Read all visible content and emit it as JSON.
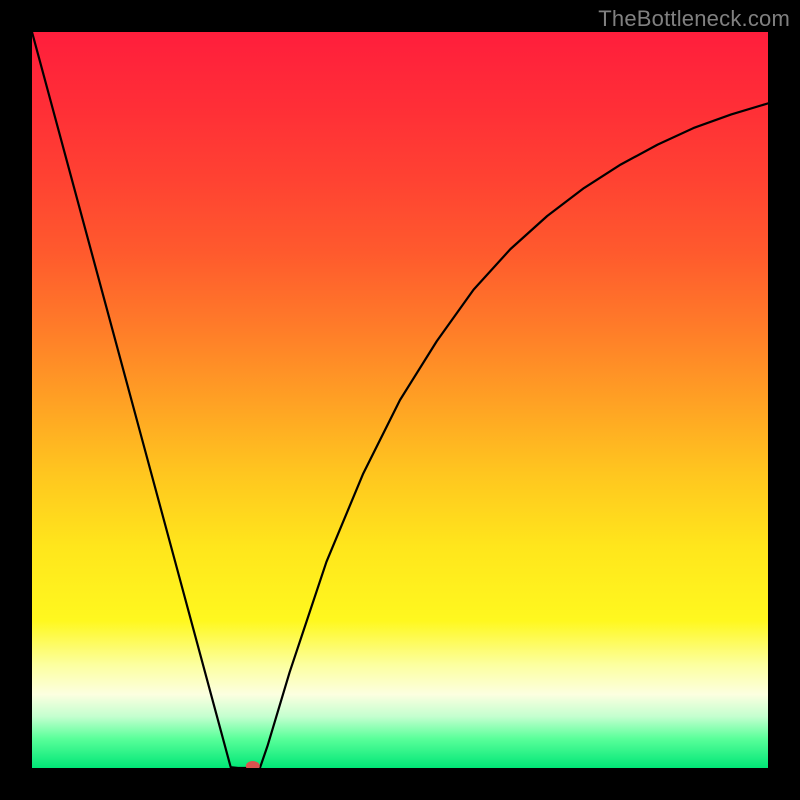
{
  "watermark": "TheBottleneck.com",
  "chart_data": {
    "type": "line",
    "title": "",
    "xlabel": "",
    "ylabel": "",
    "xlim": [
      0,
      100
    ],
    "ylim": [
      0,
      100
    ],
    "grid": false,
    "legend": false,
    "series": [
      {
        "name": "curve",
        "x": [
          0,
          5,
          10,
          15,
          20,
          25,
          27,
          28,
          29,
          30,
          31,
          32,
          35,
          40,
          45,
          50,
          55,
          60,
          65,
          70,
          75,
          80,
          85,
          90,
          95,
          100
        ],
        "y": [
          100,
          81.5,
          63,
          44.5,
          26,
          7.5,
          0.1,
          0,
          0,
          0,
          0.1,
          3,
          13,
          28,
          40,
          50,
          58,
          65,
          70.5,
          75,
          78.8,
          82,
          84.7,
          87,
          88.8,
          90.3
        ]
      }
    ],
    "marker": {
      "x": 30,
      "y": 0,
      "color": "#d9534f",
      "rx": 7,
      "ry": 5
    },
    "background_gradient": {
      "stops": [
        {
          "y": 0,
          "color": "#ff1e3c"
        },
        {
          "y": 10,
          "color": "#ff2e37"
        },
        {
          "y": 20,
          "color": "#ff4232"
        },
        {
          "y": 30,
          "color": "#ff5a2d"
        },
        {
          "y": 40,
          "color": "#ff7b29"
        },
        {
          "y": 50,
          "color": "#ffa024"
        },
        {
          "y": 60,
          "color": "#ffc61f"
        },
        {
          "y": 70,
          "color": "#ffe61c"
        },
        {
          "y": 80,
          "color": "#fff81f"
        },
        {
          "y": 86,
          "color": "#fcffa0"
        },
        {
          "y": 90,
          "color": "#fcffe0"
        },
        {
          "y": 93,
          "color": "#c4ffcf"
        },
        {
          "y": 96,
          "color": "#5aff9a"
        },
        {
          "y": 100,
          "color": "#00e676"
        }
      ]
    }
  }
}
